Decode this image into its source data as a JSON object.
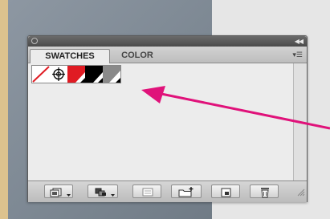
{
  "panel": {
    "tabs": [
      {
        "label": "SWATCHES",
        "active": true
      },
      {
        "label": "COLOR",
        "active": false
      }
    ],
    "swatches": [
      {
        "name": "None",
        "icon": "none-swatch-icon"
      },
      {
        "name": "Registration",
        "icon": "registration-swatch-icon"
      },
      {
        "name": "Red",
        "icon": "red-swatch-icon",
        "color": "#e01b23"
      },
      {
        "name": "Black",
        "icon": "black-swatch-icon",
        "color": "#000000"
      },
      {
        "name": "Gray",
        "icon": "gray-swatch-icon",
        "color": "#8a8a8a"
      }
    ],
    "bottom_buttons": [
      "swatch-libraries-menu-icon",
      "show-swatch-kinds-menu-icon",
      "swatch-options-icon",
      "new-color-group-icon",
      "new-swatch-icon",
      "delete-swatch-icon"
    ]
  },
  "annotation": {
    "arrow_color": "#e0127a"
  },
  "colors": {
    "border_left": "#dcc28e",
    "canvas_right": "#e6e6e6",
    "panel_bg": "#ececec"
  }
}
